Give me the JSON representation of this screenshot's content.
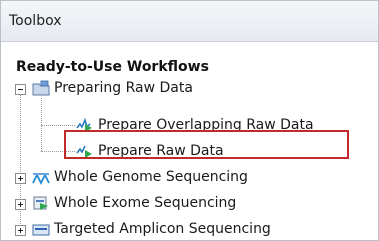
{
  "panel": {
    "title": "Toolbox"
  },
  "tree": {
    "section_heading": "Ready-to-Use Workflows",
    "folder": {
      "label": "Preparing Raw Data",
      "children": [
        {
          "label": "Prepare Overlapping Raw Data",
          "icon": "workflow-icon"
        },
        {
          "label": "Prepare Raw Data",
          "icon": "workflow-icon",
          "highlighted": true
        }
      ]
    },
    "items": [
      {
        "label": "Whole Genome Sequencing",
        "icon": "genome-workflow-icon"
      },
      {
        "label": "Whole Exome Sequencing",
        "icon": "exome-workflow-icon"
      },
      {
        "label": "Targeted Amplicon Sequencing",
        "icon": "amplicon-workflow-icon"
      }
    ]
  },
  "colors": {
    "highlight_border": "#c22a2a"
  }
}
